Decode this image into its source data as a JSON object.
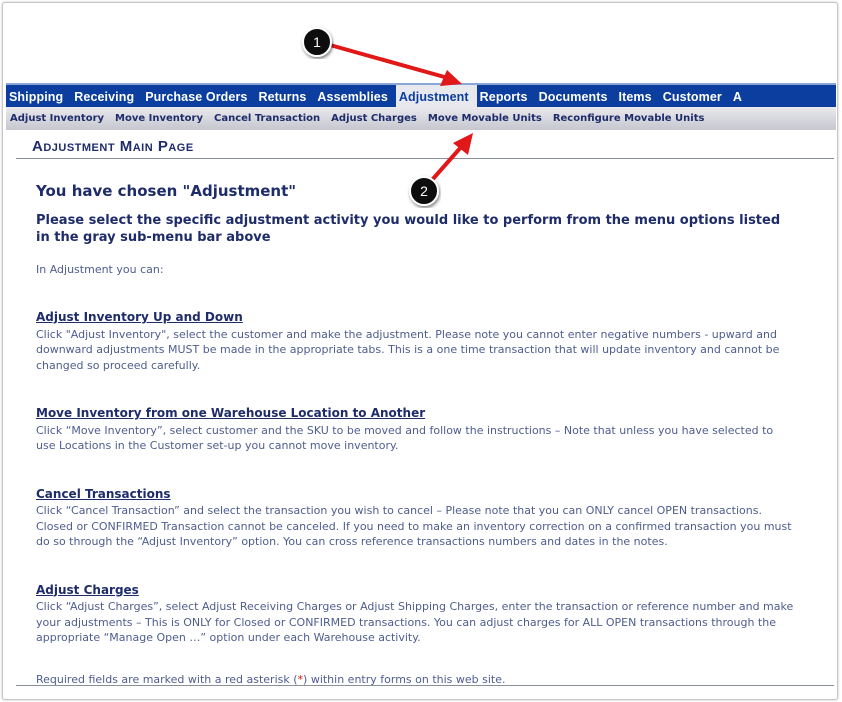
{
  "nav": {
    "items": [
      "Shipping",
      "Receiving",
      "Purchase Orders",
      "Returns",
      "Assemblies",
      "Adjustment",
      "Reports",
      "Documents",
      "Items",
      "Customer",
      "A"
    ],
    "active": "Adjustment"
  },
  "submenu": {
    "items": [
      "Adjust Inventory",
      "Move Inventory",
      "Cancel Transaction",
      "Adjust Charges",
      "Move Movable Units",
      "Reconfigure Movable Units"
    ]
  },
  "page_title": "Adjustment Main Page",
  "heading": "You have chosen \"Adjustment\"",
  "subheading": "Please select the specific adjustment activity you would like to perform from the menu options listed in the gray sub-menu bar above",
  "intro": "In Adjustment you can:",
  "sections": [
    {
      "title": "Adjust Inventory Up and Down",
      "text": "Click \"Adjust Inventory\", select the customer and make the adjustment. Please note you cannot enter negative numbers - upward and downward adjustments MUST be made in the appropriate tabs. This is a one time transaction that will update inventory and cannot be changed so proceed carefully."
    },
    {
      "title": "Move Inventory from one Warehouse Location to Another",
      "text": "Click “Move Inventory”, select customer and the SKU to be moved and follow the instructions – Note that unless you have selected to use Locations in the Customer set-up you cannot move inventory."
    },
    {
      "title": "Cancel Transactions",
      "text": "Click “Cancel Transaction” and select the transaction you wish to cancel – Please note that you can ONLY cancel OPEN transactions. Closed or CONFIRMED Transaction cannot be canceled. If you need to make an inventory correction on a confirmed transaction you must do so through the “Adjust Inventory” option. You can cross reference transactions numbers and dates in the notes."
    },
    {
      "title": "Adjust Charges",
      "text": "Click “Adjust Charges”, select Adjust Receiving Charges or Adjust Shipping Charges, enter the transaction or reference number and make your adjustments – This is ONLY for Closed or CONFIRMED transactions. You can adjust charges for ALL OPEN transactions through the appropriate “Manage Open …” option under each Warehouse activity."
    }
  ],
  "required": {
    "before": "Required fields are marked with a red asterisk (",
    "star": "*",
    "after": ") within entry forms on this web site."
  },
  "callouts": [
    "1",
    "2"
  ],
  "colors": {
    "nav": "#0b3e9e",
    "text": "#1e2c6a",
    "arrow": "#e01818"
  }
}
